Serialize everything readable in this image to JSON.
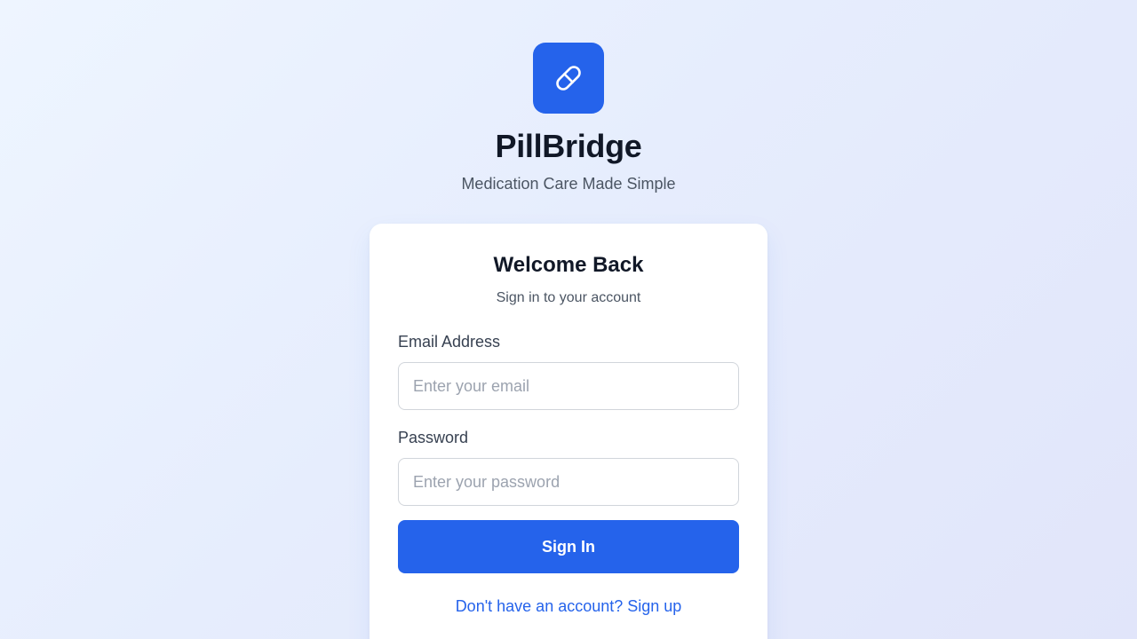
{
  "brand": {
    "logo_icon": "pill-icon",
    "name": "PillBridge",
    "tagline": "Medication Care Made Simple"
  },
  "login_card": {
    "title": "Welcome Back",
    "subtitle": "Sign in to your account",
    "email": {
      "label": "Email Address",
      "placeholder": "Enter your email",
      "value": ""
    },
    "password": {
      "label": "Password",
      "placeholder": "Enter your password",
      "value": ""
    },
    "submit_label": "Sign In",
    "signup_prompt": "Don't have an account? Sign up"
  },
  "colors": {
    "accent": "#2563eb",
    "heading": "#111827",
    "muted_text": "#4b5563",
    "input_border": "#d1d5db",
    "placeholder": "#9ca3af"
  }
}
